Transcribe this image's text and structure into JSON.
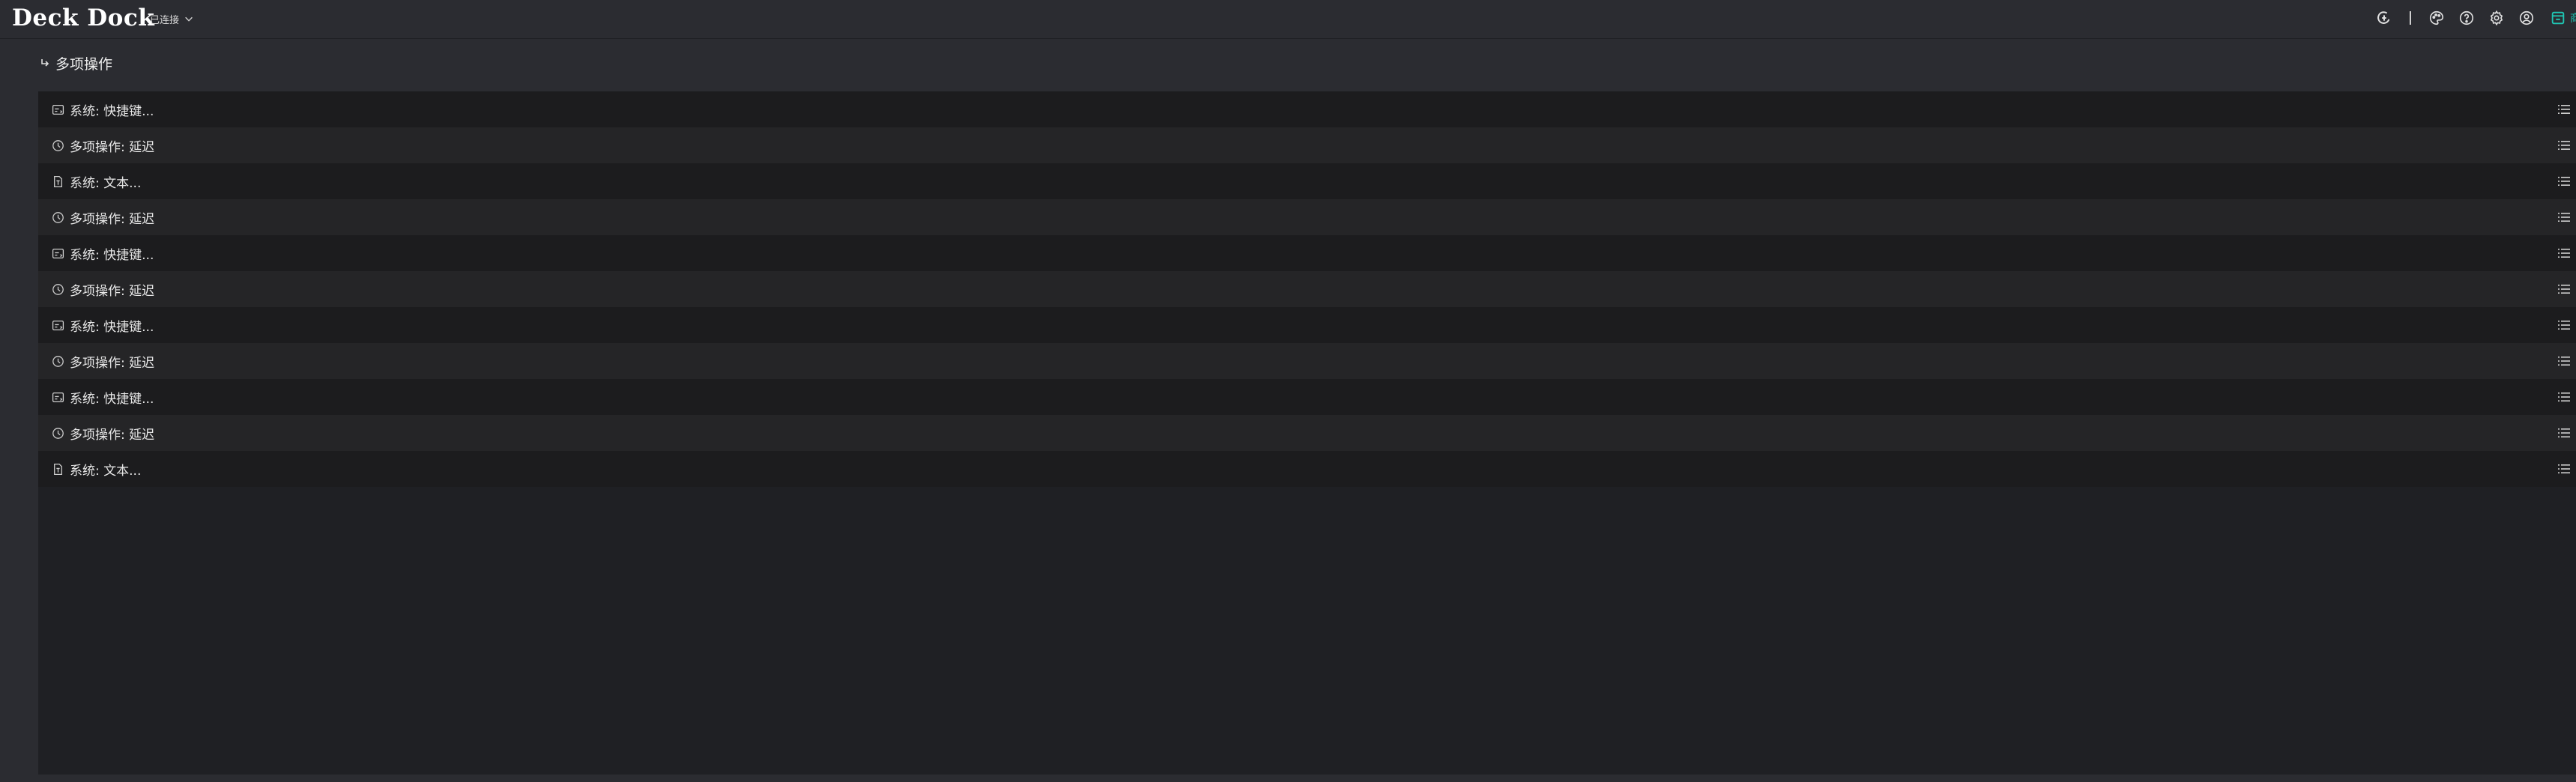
{
  "app": {
    "title": "Deck Dock"
  },
  "connection": {
    "status": "已连接"
  },
  "breadcrumb": {
    "title": "多项操作"
  },
  "actions": [
    {
      "icon": "keyboard-icon",
      "label": "系统: 快捷键..."
    },
    {
      "icon": "clock-icon",
      "label": "多项操作: 延迟"
    },
    {
      "icon": "document-icon",
      "label": "系统: 文本..."
    },
    {
      "icon": "clock-icon",
      "label": "多项操作: 延迟"
    },
    {
      "icon": "keyboard-icon",
      "label": "系统: 快捷键..."
    },
    {
      "icon": "clock-icon",
      "label": "多项操作: 延迟"
    },
    {
      "icon": "keyboard-icon",
      "label": "系统: 快捷键..."
    },
    {
      "icon": "clock-icon",
      "label": "多项操作: 延迟"
    },
    {
      "icon": "keyboard-icon",
      "label": "系统: 快捷键..."
    },
    {
      "icon": "clock-icon",
      "label": "多项操作: 延迟"
    },
    {
      "icon": "document-icon",
      "label": "系统: 文本..."
    }
  ],
  "colors": {
    "accent": "#1fc7b4",
    "background": "#2b2c31",
    "panel": "#1f2024"
  }
}
